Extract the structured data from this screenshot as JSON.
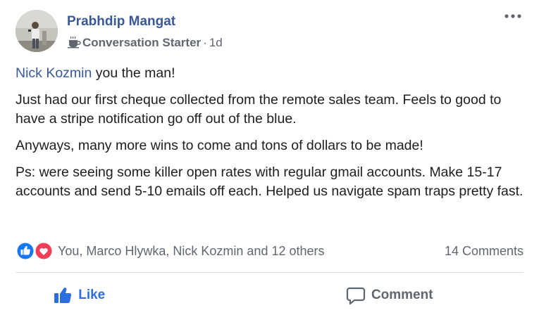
{
  "post": {
    "author": {
      "name": "Prabhdip Mangat",
      "badge_icon": "coffee-cup-icon",
      "badge_label": "Conversation Starter",
      "separator": "·",
      "timestamp": "1d"
    },
    "menu_icon": "more-options-icon",
    "body": {
      "mention": "Nick Kozmin",
      "first_line_rest": " you the man!",
      "paragraphs": [
        "Just had our first cheque collected from the remote sales team. Feels to good to have a stripe notification go off out of the blue.",
        "Anyways, many more wins to come and tons of dollars to be made!",
        "Ps: were seeing some killer open rates with regular gmail accounts. Make 15-17 accounts and send 5-10 emails off each. Helped us navigate spam traps pretty fast."
      ]
    },
    "reactions": {
      "icons": [
        "like-reaction-icon",
        "love-reaction-icon"
      ],
      "summary": "You, Marco Hlywka, Nick Kozmin and 12 others",
      "comments_count": "14 Comments"
    },
    "actions": {
      "like_label": "Like",
      "comment_label": "Comment"
    },
    "colors": {
      "link": "#385898",
      "like_active": "#2d6fe0",
      "muted": "#606770",
      "text": "#1c1e21",
      "love": "#f33e58"
    }
  }
}
